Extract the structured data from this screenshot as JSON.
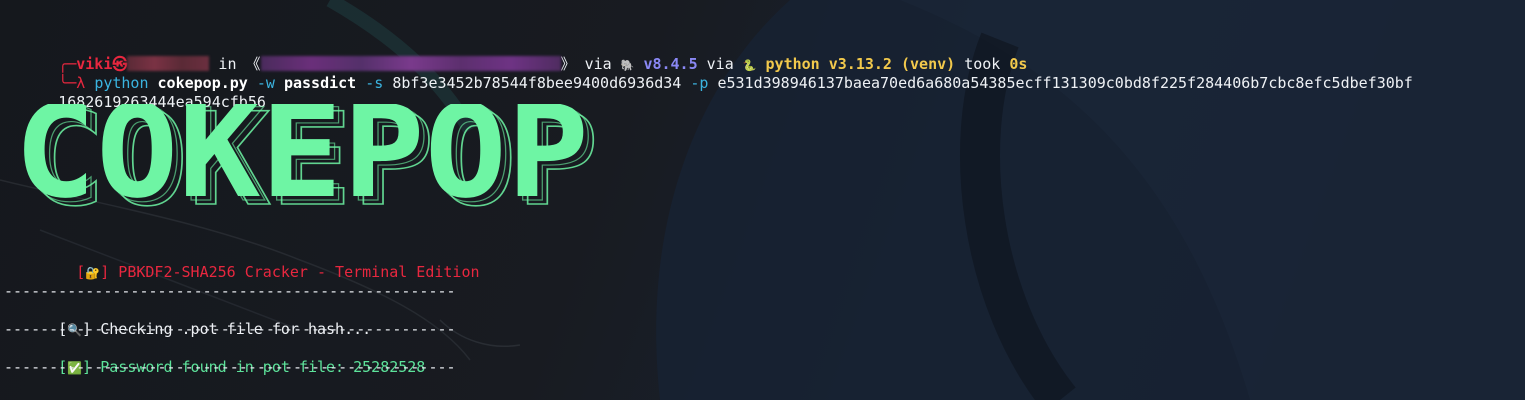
{
  "prompt": {
    "user": "viki",
    "at_symbol": "㉿",
    "in_word": "in",
    "open_bracket": "《",
    "close_bracket": "》",
    "via1": "via",
    "php_icon": "🐘",
    "php_version": "v8.4.5",
    "via2": "via",
    "python_icon": "🐍",
    "python_version": "python v3.13.2 (venv)",
    "took_word": "took",
    "took_value": "0s",
    "lambda": "λ",
    "cmd_python": "python",
    "cmd_script": "cokepop.py",
    "flag_w": "-w",
    "arg_w": "passdict",
    "flag_s": "-s",
    "arg_s": "8bf3e3452b78544f8bee9400d6936d34",
    "flag_p": "-p",
    "arg_p_line1": "e531d398946137baea70ed6a680a54385ecff131309c0bd8f225f284406b7cbc8efc5dbef30bf",
    "arg_p_line2": "1682619263444ea594cfb56"
  },
  "logo": {
    "text": "COKEPOP",
    "color": "#6ef5a4",
    "shadow_color": "#6ef5a4"
  },
  "output": {
    "subtitle_open": "[",
    "subtitle_icon": "🔐",
    "subtitle_close": "]",
    "subtitle_text": "PBKDF2-SHA256 Cracker - Terminal Edition",
    "separator": "--------------------------------------------------",
    "check_open": "[",
    "check_icon": "🔍",
    "check_close": "]",
    "check_text": "Checking .pot file for hash...",
    "found_open": "[",
    "found_icon": "✅",
    "found_close": "]",
    "found_text": "Password found in pot file: 25282528"
  }
}
